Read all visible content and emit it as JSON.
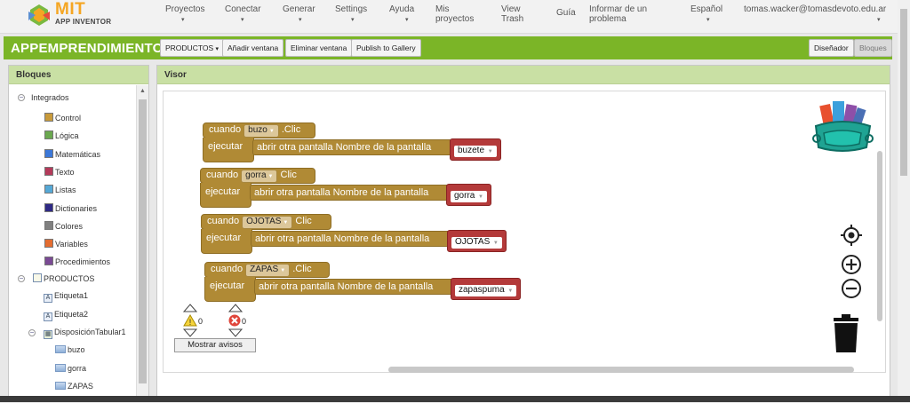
{
  "brand": {
    "mit": "MIT",
    "appinventor": "APP INVENTOR"
  },
  "nav": [
    {
      "label": "Proyectos",
      "caret": true
    },
    {
      "label": "Conectar",
      "caret": true
    },
    {
      "label": "Generar",
      "caret": true
    },
    {
      "label": "Settings",
      "caret": true
    },
    {
      "label": "Ayuda",
      "caret": true
    },
    {
      "label": "Mis\nproyectos",
      "caret": false
    },
    {
      "label": "View\nTrash",
      "caret": false
    },
    {
      "label": "Guía",
      "caret": false
    },
    {
      "label": "Informar de un\nproblema",
      "caret": false
    },
    {
      "label": "Español",
      "caret": true
    },
    {
      "label": "tomas.wacker@tomasdevoto.edu.ar",
      "caret": true
    }
  ],
  "project": {
    "name": "APPEMPRENDIMIENTO",
    "screen_dropdown": "PRODUCTOS",
    "add_screen": "Añadir ventana",
    "remove_screen": "Eliminar ventana",
    "publish": "Publish to Gallery",
    "designer": "Diseñador",
    "blocks": "Bloques"
  },
  "left": {
    "title": "Bloques",
    "builtin_label": "Integrados",
    "builtin": [
      {
        "label": "Control",
        "color": "#c89a3a"
      },
      {
        "label": "Lógica",
        "color": "#6aa84f"
      },
      {
        "label": "Matemáticas",
        "color": "#3c78d8"
      },
      {
        "label": "Texto",
        "color": "#b43a5a"
      },
      {
        "label": "Listas",
        "color": "#55a8d6"
      },
      {
        "label": "Dictionaries",
        "color": "#2e2a85"
      },
      {
        "label": "Colores",
        "color": "#808080"
      },
      {
        "label": "Variables",
        "color": "#e46d30"
      },
      {
        "label": "Procedimientos",
        "color": "#7a4a94"
      }
    ],
    "screen_label": "PRODUCTOS",
    "components": [
      {
        "label": "Etiqueta1",
        "kind": "label"
      },
      {
        "label": "Etiqueta2",
        "kind": "label"
      },
      {
        "label": "DisposiciónTabular1",
        "kind": "table"
      }
    ],
    "children": [
      "buzo",
      "gorra",
      "ZAPAS"
    ]
  },
  "viewer": {
    "title": "Visor",
    "blocks": [
      {
        "when": "cuando",
        "component": "buzo",
        "event": ".Clic",
        "do": "ejecutar",
        "call": "abrir otra pantalla",
        "param": "Nombre de la pantalla",
        "value": "buzete"
      },
      {
        "when": "cuando",
        "component": "gorra",
        "event": "Clic",
        "do": "ejecutar",
        "call": "abrir otra pantalla",
        "param": "Nombre de la pantalla",
        "value": "gorra"
      },
      {
        "when": "cuando",
        "component": "OJOTAS",
        "event": "Clic",
        "do": "ejecutar",
        "call": "abrir otra pantalla",
        "param": "Nombre de la pantalla",
        "value": "OJOTAS"
      },
      {
        "when": "cuando",
        "component": "ZAPAS",
        "event": ".Clic",
        "do": "ejecutar",
        "call": "abrir otra pantalla",
        "param": "Nombre de la pantalla",
        "value": "zapaspuma"
      }
    ],
    "warnings": {
      "count": "0",
      "errors": "0",
      "show": "Mostrar avisos"
    }
  }
}
